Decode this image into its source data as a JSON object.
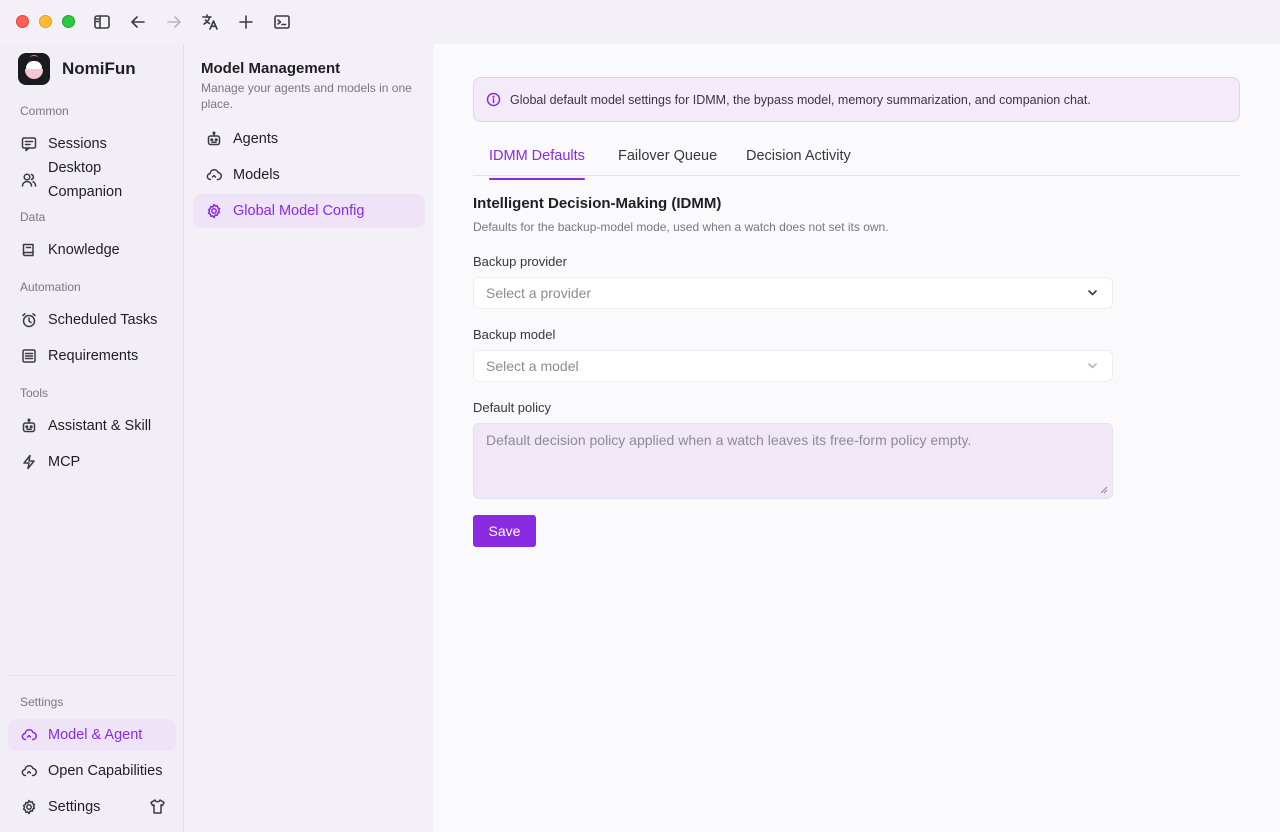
{
  "app": {
    "name": "NomiFun"
  },
  "colors": {
    "accent": "#8a2be2",
    "active_bg": "#efe3f8"
  },
  "sidebar": {
    "sections": {
      "common": "Common",
      "data": "Data",
      "automation": "Automation",
      "tools": "Tools",
      "settings": "Settings"
    },
    "items": {
      "sessions": "Sessions",
      "desktop_companion": "Desktop Companion",
      "knowledge": "Knowledge",
      "scheduled_tasks": "Scheduled Tasks",
      "requirements": "Requirements",
      "assistant_skill": "Assistant & Skill",
      "mcp": "MCP",
      "model_agent": "Model & Agent",
      "open_capabilities": "Open Capabilities",
      "settings": "Settings"
    },
    "active": "Model & Agent"
  },
  "panel": {
    "title": "Model Management",
    "subtitle": "Manage your agents and models in one place.",
    "items": {
      "agents": "Agents",
      "models": "Models",
      "global_model_config": "Global Model Config"
    },
    "active": "Global Model Config"
  },
  "main": {
    "banner": "Global default model settings for IDMM, the bypass model, memory summarization, and companion chat.",
    "tabs": {
      "idmm_defaults": "IDMM Defaults",
      "failover_queue": "Failover Queue",
      "decision_activity": "Decision Activity"
    },
    "active_tab": "IDMM Defaults",
    "section_title": "Intelligent Decision-Making (IDMM)",
    "section_desc": "Defaults for the backup-model mode, used when a watch does not set its own.",
    "backup_provider": {
      "label": "Backup provider",
      "placeholder": "Select a provider"
    },
    "backup_model": {
      "label": "Backup model",
      "placeholder": "Select a model"
    },
    "default_policy": {
      "label": "Default policy",
      "placeholder": "Default decision policy applied when a watch leaves its free-form policy empty."
    },
    "save_label": "Save"
  }
}
